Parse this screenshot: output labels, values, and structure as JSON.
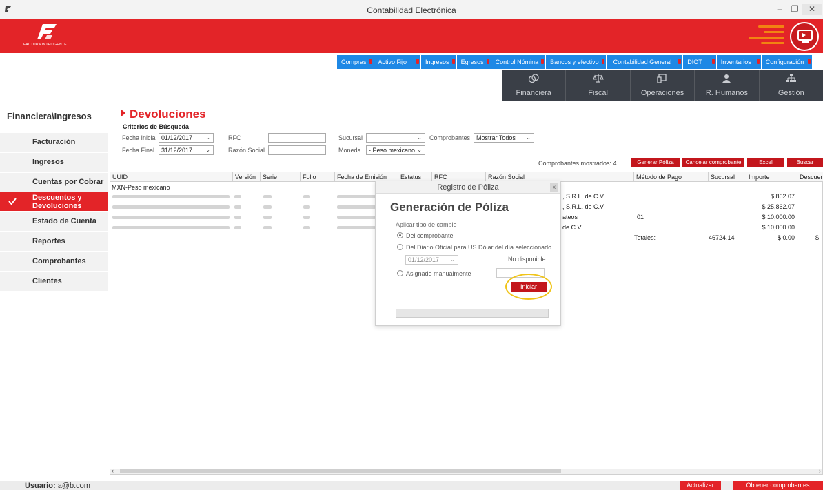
{
  "window": {
    "title": "Contabilidad Electrónica",
    "minimize_glyph": "–",
    "maximize_glyph": "❐",
    "close_glyph": "✕"
  },
  "brand": {
    "logo_text": "FACTURA INTELIGENTE",
    "accent": "#e32428",
    "menu_blue": "#1e88e5",
    "module_dark": "#3a3f47"
  },
  "topmenu": [
    {
      "label": "Compras"
    },
    {
      "label": "Activo Fijo"
    },
    {
      "label": "Ingresos"
    },
    {
      "label": "Egresos"
    },
    {
      "label": "Control Nómina"
    },
    {
      "label": "Bancos y efectivo"
    },
    {
      "label": "Contabilidad General"
    },
    {
      "label": "DIOT"
    },
    {
      "label": "Inventarios"
    },
    {
      "label": "Configuración"
    }
  ],
  "modules": [
    {
      "label": "Financiera",
      "icon": "coins-icon"
    },
    {
      "label": "Fiscal",
      "icon": "scale-icon"
    },
    {
      "label": "Operaciones",
      "icon": "devices-icon"
    },
    {
      "label": "R. Humanos",
      "icon": "person-icon"
    },
    {
      "label": "Gestión",
      "icon": "org-chart-icon"
    }
  ],
  "sidebar": {
    "section_title": "Financiera\\Ingresos",
    "items": [
      {
        "label": "Facturación"
      },
      {
        "label": "Ingresos"
      },
      {
        "label": "Cuentas por Cobrar"
      },
      {
        "label": "Descuentos y Devoluciones",
        "line1": "Descuentos y",
        "line2": "Devoluciones",
        "active": true
      },
      {
        "label": "Estado de Cuenta"
      },
      {
        "label": "Reportes"
      },
      {
        "label": "Comprobantes"
      },
      {
        "label": "Clientes"
      }
    ]
  },
  "page": {
    "title": "Devoluciones",
    "criteria_title": "Criterios de Búsqueda"
  },
  "filters": {
    "fecha_inicial_label": "Fecha Inicial",
    "fecha_inicial": "01/12/2017",
    "fecha_final_label": "Fecha Final",
    "fecha_final": "31/12/2017",
    "rfc_label": "RFC",
    "rfc": "",
    "razon_social_label": "Razón Social",
    "razon_social": "",
    "sucursal_label": "Sucursal",
    "sucursal": "",
    "moneda_label": "Moneda",
    "moneda": "- Peso mexicano",
    "comprobantes_label": "Comprobantes",
    "comprobantes": "Mostrar Todos"
  },
  "toolbar": {
    "shown_count": "Comprobantes mostrados: 4",
    "generar_poliza": "Generar Póliza",
    "cancelar": "Cancelar comprobante",
    "excel": "Excel",
    "buscar": "Buscar"
  },
  "grid": {
    "columns": [
      "UUID",
      "Versión",
      "Serie",
      "Folio",
      "Fecha de Emisión",
      "Estatus",
      "RFC",
      "Razón Social",
      "Método de Pago",
      "Sucursal",
      "Importe",
      "Descuento"
    ],
    "group_label": "MXN-Peso mexicano",
    "rows": [
      {
        "razon_social": ", S.R.L. de C.V.",
        "metodo_pago": "",
        "sucursal": "",
        "importe": "$ 862.07"
      },
      {
        "razon_social": ", S.R.L. de C.V.",
        "metodo_pago": "",
        "sucursal": "",
        "importe": "$ 25,862.07"
      },
      {
        "razon_social": "ateos",
        "metodo_pago": "01",
        "sucursal": "",
        "importe": "$ 10,000.00"
      },
      {
        "razon_social": "de C.V.",
        "metodo_pago": "",
        "sucursal": "",
        "importe": "$ 10,000.00"
      }
    ],
    "totals_label": "Totales:",
    "totals_sucursal": "46724.14",
    "totals_importe": "$ 0.00",
    "totals_descuento": "$"
  },
  "dialog": {
    "title": "Registro de Póliza",
    "close": "x",
    "heading": "Generación de Póliza",
    "subtitle": "Aplicar tipo de cambio",
    "option_comprobante": "Del comprobante",
    "option_diario": "Del Diario Oficial para US Dólar del día seleccionado",
    "date": "01/12/2017",
    "no_disponible": "No disponible",
    "option_manual": "Asignado manualmente",
    "iniciar": "Iniciar",
    "progress": 0
  },
  "statusbar": {
    "user_label": "Usuario:",
    "user": "a@b.com",
    "actualizar": "Actualizar",
    "obtener": "Obtener comprobantes"
  }
}
